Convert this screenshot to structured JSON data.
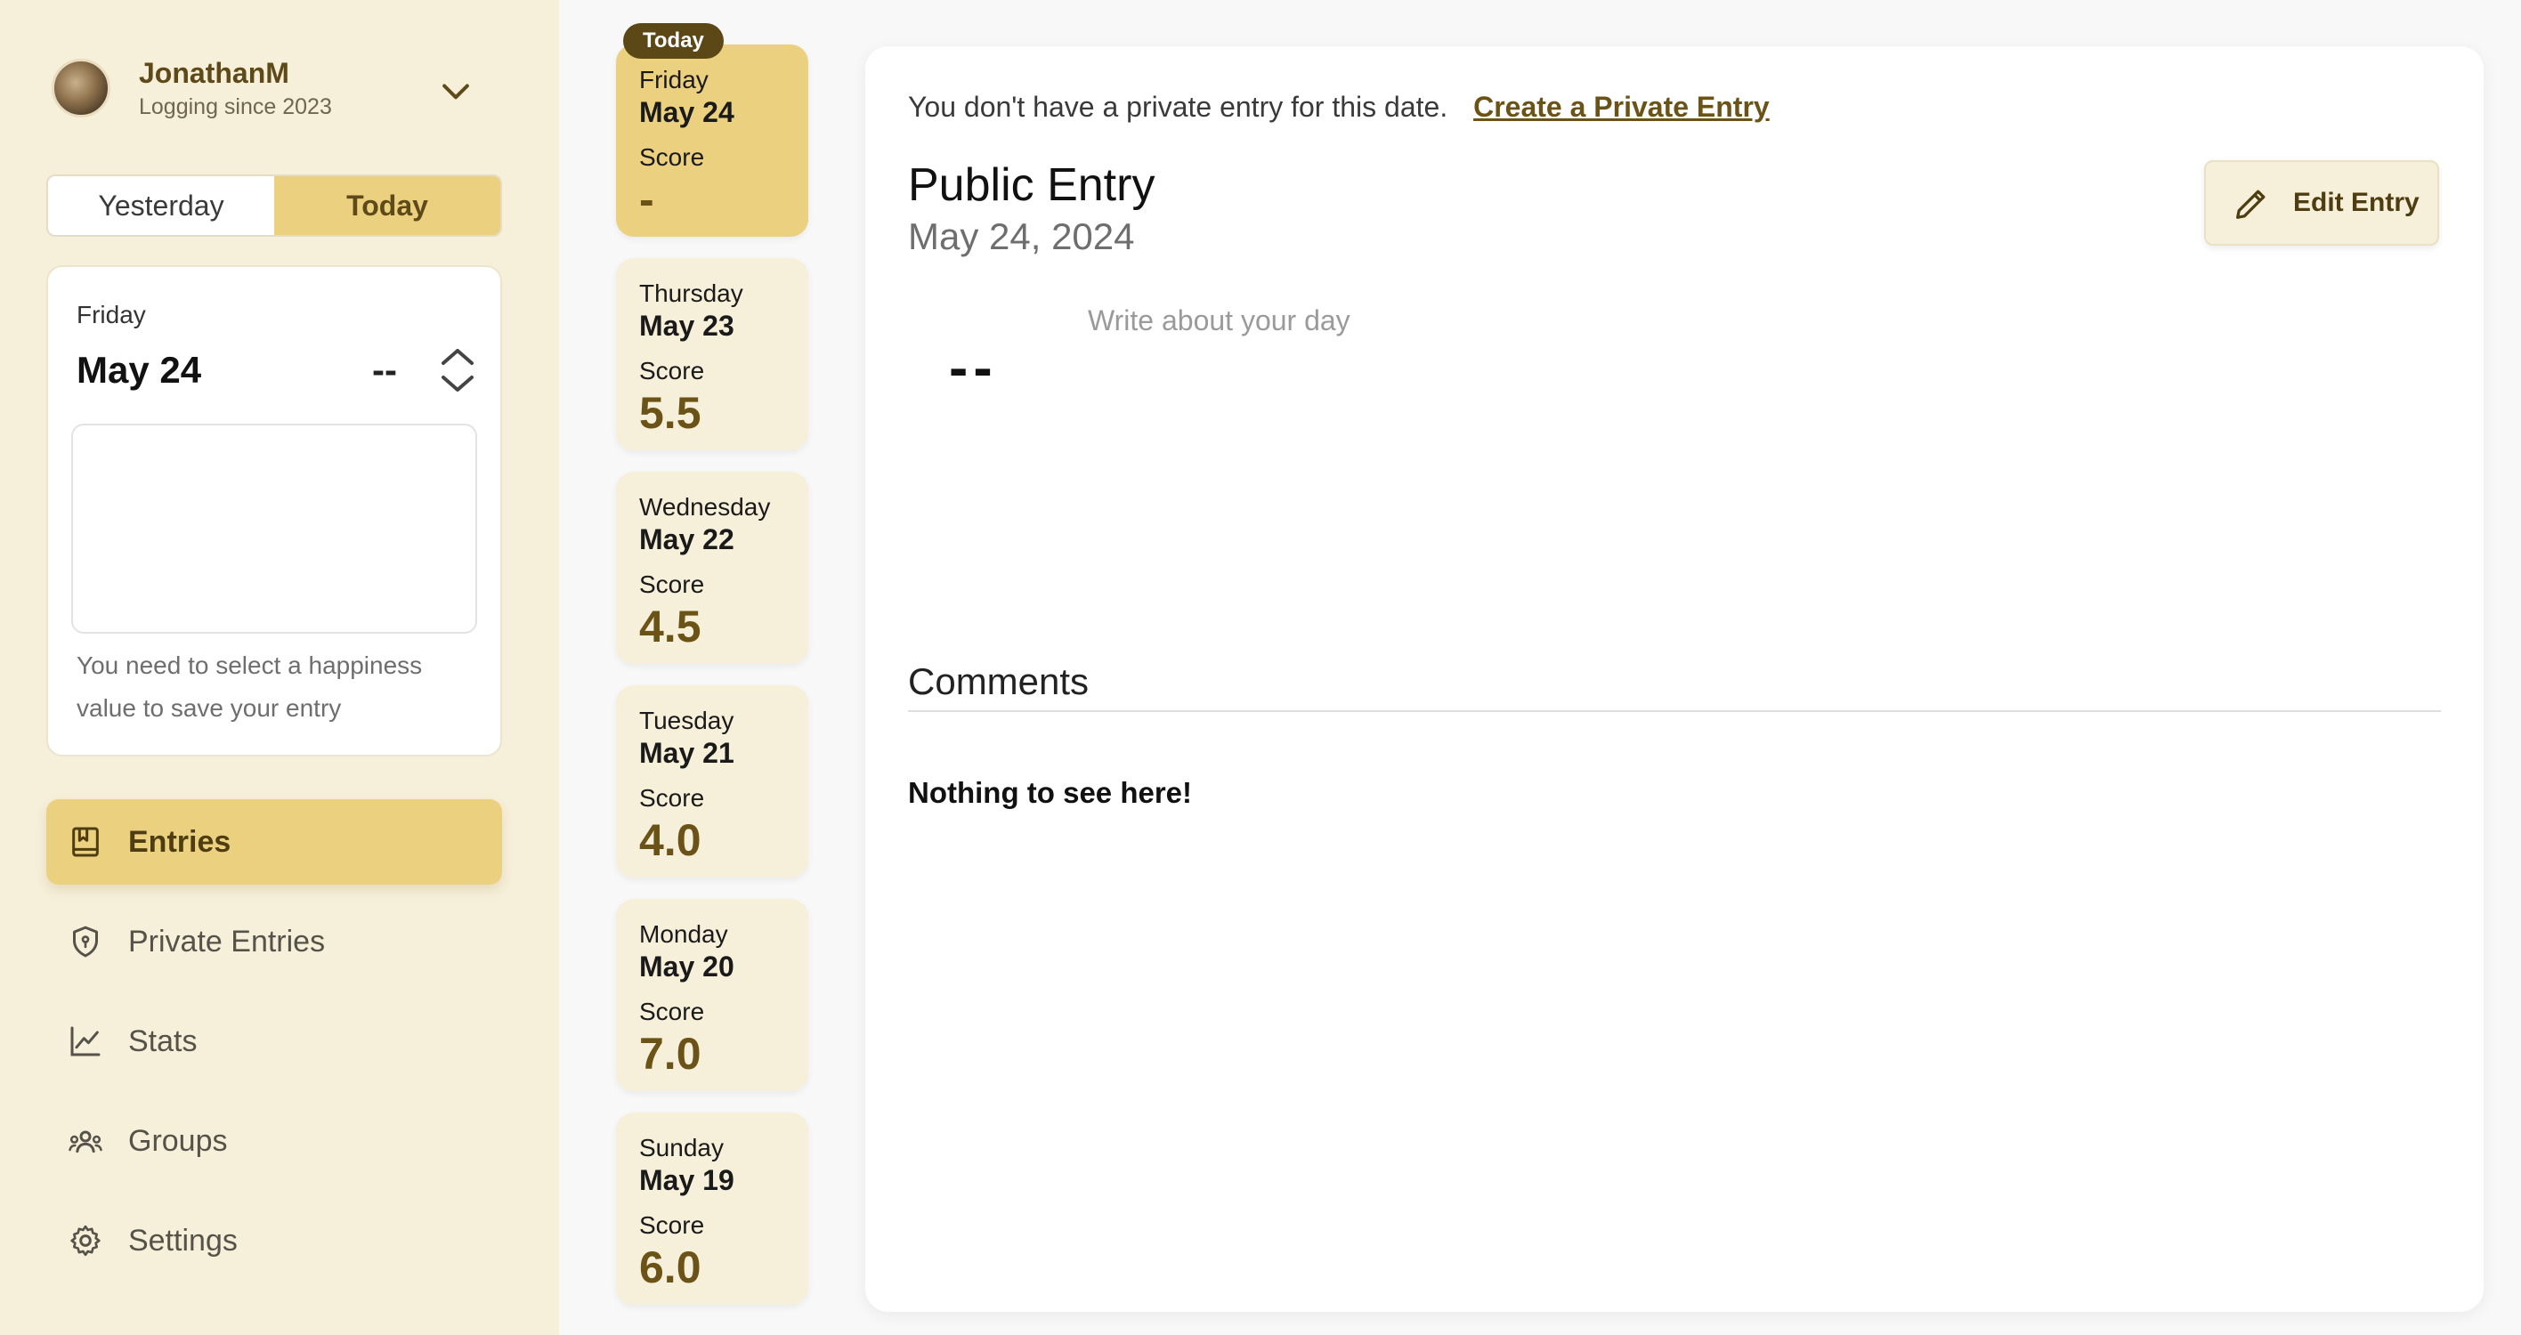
{
  "profile": {
    "name": "JonathanM",
    "subtitle": "Logging since 2023"
  },
  "day_toggle": {
    "yesterday_label": "Yesterday",
    "today_label": "Today",
    "selected": "Today"
  },
  "quick_entry": {
    "day": "Friday",
    "date": "May 24",
    "score": "--",
    "text_value": "",
    "hint": "You need to select a happiness value to save your entry"
  },
  "nav": {
    "items": [
      {
        "label": "Entries",
        "icon": "book-icon",
        "active": true
      },
      {
        "label": "Private Entries",
        "icon": "shield-icon",
        "active": false
      },
      {
        "label": "Stats",
        "icon": "line-chart-icon",
        "active": false
      },
      {
        "label": "Groups",
        "icon": "users-icon",
        "active": false
      },
      {
        "label": "Settings",
        "icon": "gear-icon",
        "active": false
      }
    ]
  },
  "days": {
    "today_badge": "Today",
    "score_label": "Score",
    "items": [
      {
        "day": "Friday",
        "date": "May 24",
        "score": "-",
        "selected": true
      },
      {
        "day": "Thursday",
        "date": "May 23",
        "score": "5.5",
        "selected": false
      },
      {
        "day": "Wednesday",
        "date": "May 22",
        "score": "4.5",
        "selected": false
      },
      {
        "day": "Tuesday",
        "date": "May 21",
        "score": "4.0",
        "selected": false
      },
      {
        "day": "Monday",
        "date": "May 20",
        "score": "7.0",
        "selected": false
      },
      {
        "day": "Sunday",
        "date": "May 19",
        "score": "6.0",
        "selected": false
      }
    ]
  },
  "main": {
    "private_message": "You don't have a private entry for this date.",
    "private_link": "Create a Private Entry",
    "entry_title": "Public Entry",
    "entry_date": "May 24, 2024",
    "edit_label": "Edit Entry",
    "score": "--",
    "text_placeholder": "Write about your day",
    "comments_title": "Comments",
    "comments_empty": "Nothing to see here!"
  },
  "colors": {
    "sidebar_bg": "#f6efd9",
    "accent": "#ebd07f",
    "accent_dark": "#5c4717",
    "score_text": "#6b5318"
  }
}
